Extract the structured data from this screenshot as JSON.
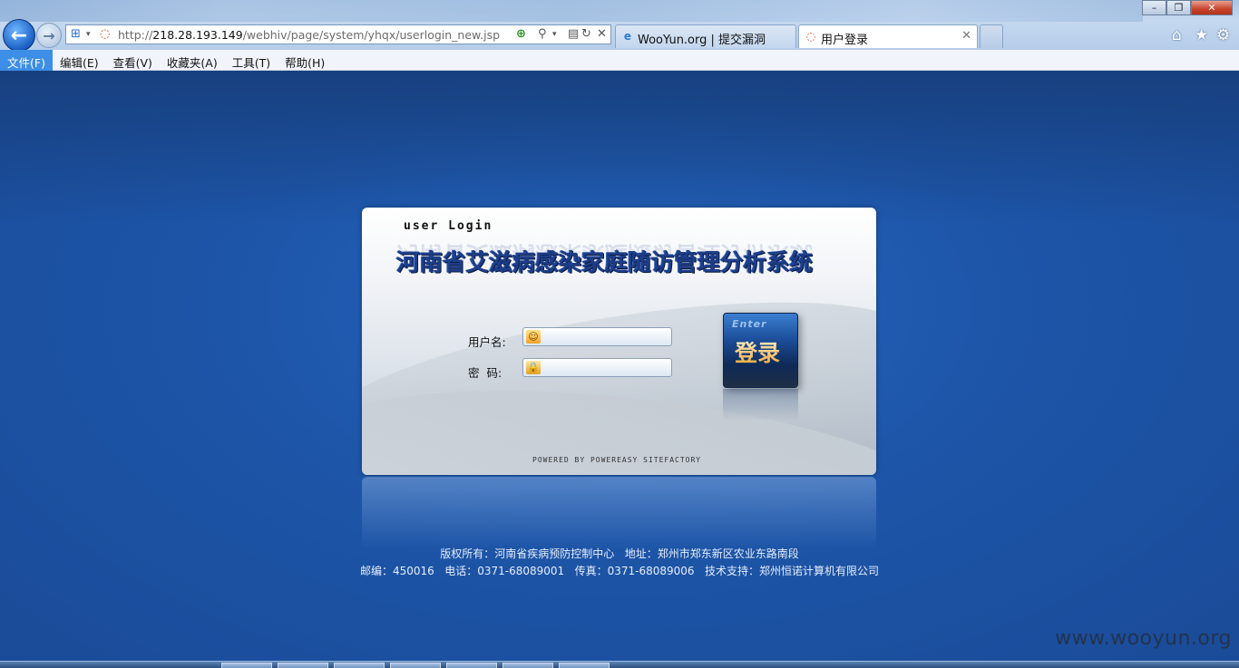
{
  "browser": {
    "url_prefix": "http://",
    "url_host": "218.28.193.149",
    "url_path": "/webhiv/page/system/yhqx/userlogin_new.jsp",
    "tabs": [
      {
        "label": "WooYun.org | 提交漏洞",
        "icon": "ie-icon",
        "active": false
      },
      {
        "label": "用户登录",
        "icon": "loading-icon",
        "active": true
      }
    ],
    "window_buttons": {
      "minimize": "–",
      "restore": "❐",
      "close": "✕"
    }
  },
  "menu": {
    "items": [
      "文件(F)",
      "编辑(E)",
      "查看(V)",
      "收藏夹(A)",
      "工具(T)",
      "帮助(H)"
    ],
    "active_index": 0
  },
  "login": {
    "heading_en": "user Login",
    "system_title": "河南省艾滋病感染家庭随访管理分析系统",
    "username_label": "用户名:",
    "password_label": "密  码:",
    "username_value": "",
    "password_value": "",
    "enter_en": "Enter",
    "enter_cn": "登录",
    "powered_by": "POWERED BY POWEREASY SITEFACTORY"
  },
  "footer": {
    "line1": "版权所有：河南省疾病预防控制中心   地址：郑州市郑东新区农业东路南段",
    "line2": "邮编：450016   电话：0371-68089001   传真：0371-68089006   技术支持：郑州恒诺计算机有限公司"
  },
  "watermark": "www.wooyun.org",
  "colors": {
    "page_bg": "#1e5ab0",
    "title_blue": "#1d3e8a",
    "menu_active": "#3d8ee6",
    "enter_button": "#1c4e9a"
  }
}
